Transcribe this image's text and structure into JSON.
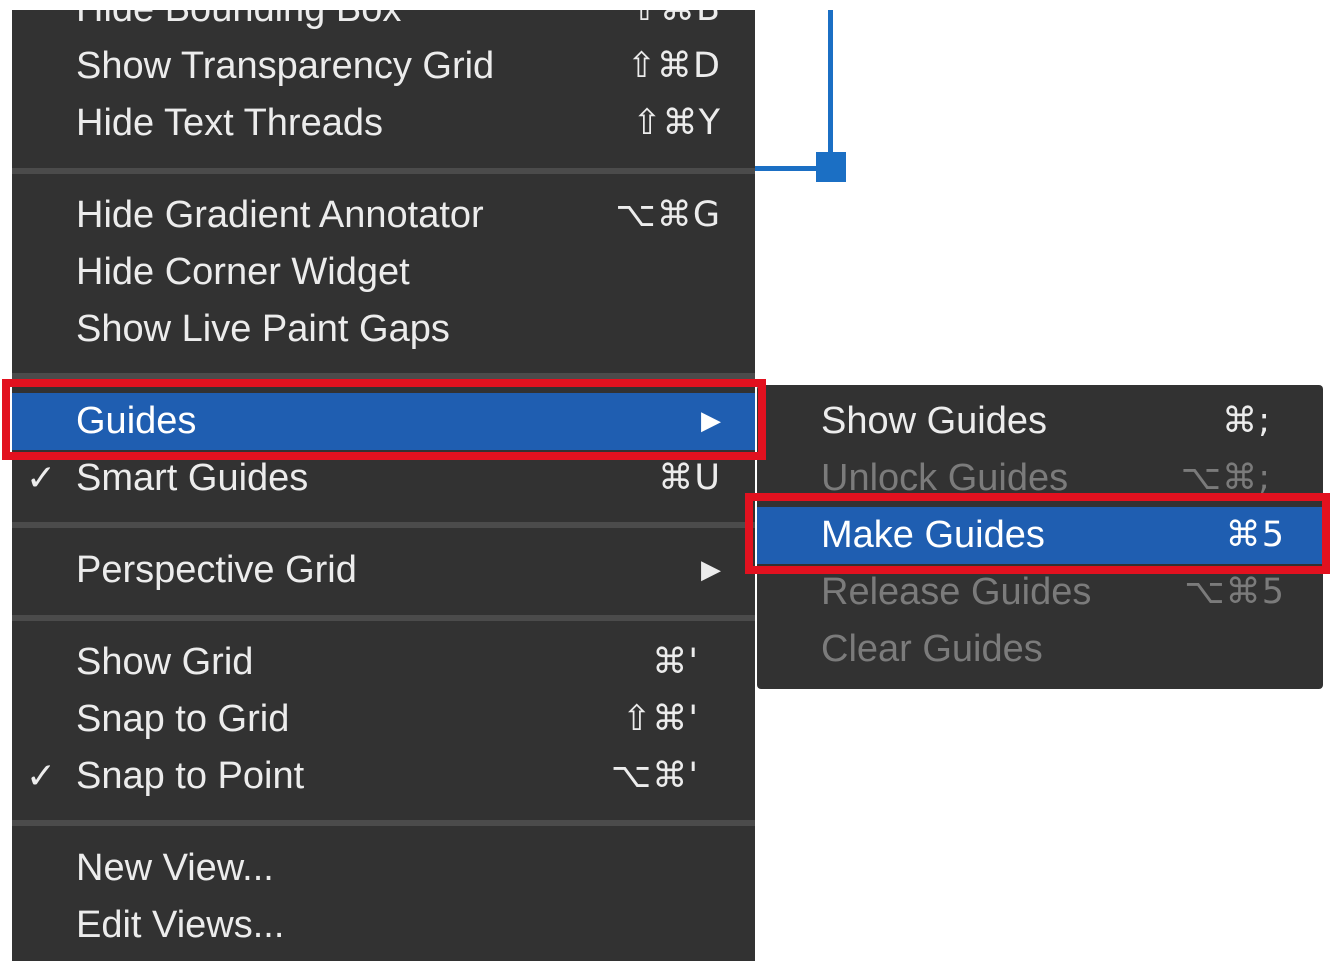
{
  "menu": {
    "items": [
      {
        "label": "Hide Bounding Box",
        "shortcut": "⇧⌘B"
      },
      {
        "label": "Show Transparency Grid",
        "shortcut": "⇧⌘D"
      },
      {
        "label": "Hide Text Threads",
        "shortcut": "⇧⌘Y"
      },
      {
        "label": "Hide Gradient Annotator",
        "shortcut": "⌥⌘G"
      },
      {
        "label": "Hide Corner Widget",
        "shortcut": ""
      },
      {
        "label": "Show Live Paint Gaps",
        "shortcut": ""
      },
      {
        "label": "Guides",
        "arrow": "▶",
        "highlighted": true
      },
      {
        "label": "Smart Guides",
        "shortcut": "⌘U",
        "checked": true
      },
      {
        "label": "Perspective Grid",
        "arrow": "▶"
      },
      {
        "label": "Show Grid",
        "shortcut": "⌘'"
      },
      {
        "label": "Snap to Grid",
        "shortcut": "⇧⌘'"
      },
      {
        "label": "Snap to Point",
        "shortcut": "⌥⌘'",
        "checked": true
      },
      {
        "label": "New View...",
        "shortcut": ""
      },
      {
        "label": "Edit Views...",
        "shortcut": ""
      }
    ],
    "check_glyph": "✓"
  },
  "submenu": {
    "items": [
      {
        "label": "Show Guides",
        "shortcut": "⌘;",
        "enabled": true
      },
      {
        "label": "Unlock Guides",
        "shortcut": "⌥⌘;",
        "enabled": false
      },
      {
        "label": "Make Guides",
        "shortcut": "⌘5",
        "enabled": true,
        "highlighted": true
      },
      {
        "label": "Release Guides",
        "shortcut": "⌥⌘5",
        "enabled": false
      },
      {
        "label": "Clear Guides",
        "shortcut": "",
        "enabled": false
      }
    ]
  },
  "colors": {
    "menu_background": "#323232",
    "highlight": "#1f5eb1",
    "emphasis_box": "#e2111f",
    "canvas_guide": "#1b6fc4",
    "disabled_text": "#7b7b7b"
  }
}
